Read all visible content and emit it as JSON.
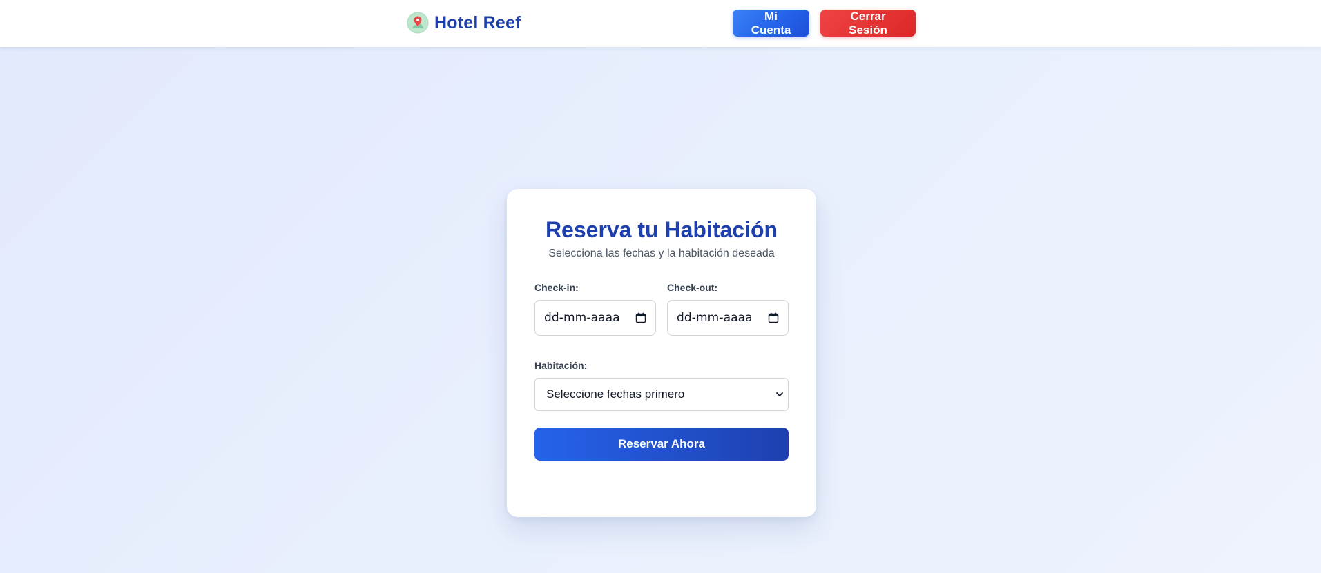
{
  "header": {
    "brand_name": "Hotel Reef",
    "logo_icon": "map-pin-icon",
    "account_label": "Mi Cuenta",
    "logout_label": "Cerrar Sesión"
  },
  "booking": {
    "title": "Reserva tu Habitación",
    "subtitle": "Selecciona las fechas y la habitación deseada",
    "checkin": {
      "label": "Check-in:",
      "value": "dd-mm-aaaa",
      "icon": "calendar-icon"
    },
    "checkout": {
      "label": "Check-out:",
      "value": "dd-mm-aaaa",
      "icon": "calendar-icon"
    },
    "room": {
      "label": "Habitación:",
      "selected": "Seleccione fechas primero",
      "icon": "chevron-down-icon"
    },
    "submit_label": "Reservar Ahora"
  },
  "colors": {
    "brand": "#1e40af",
    "primary": "#2563eb",
    "danger": "#dc2626",
    "background": "#e6edfc"
  }
}
